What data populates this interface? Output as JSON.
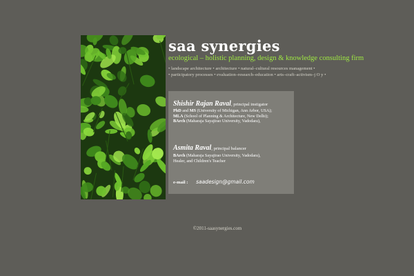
{
  "brand": {
    "title": "saa synergies",
    "tagline": "ecological – holistic planning, design & knowledge consulting firm"
  },
  "services": {
    "line1": "• landscape architecture • architecture • natural–cultural resources management •",
    "line2": "• participatory processes • evaluation–research–education • arts–craft–activism–j O y •"
  },
  "photo": {
    "subject": "green leaves"
  },
  "people": [
    {
      "name": "Shishir Rajan Raval",
      "role": ", principal instigator",
      "credentials": [
        {
          "degree": "PhD",
          "connector": " and ",
          "degree2": "MS",
          "detail": " (University of Michigan, Ann Arbor, USA);"
        },
        {
          "degree": "MLA",
          "detail": " (School of Planning & Architecture, New Delhi);"
        },
        {
          "degree": "BArch",
          "detail": " (Maharaja Sayajirao University, Vadodara),"
        }
      ]
    },
    {
      "name": "Asmita Raval",
      "role": ", principal balancer",
      "credentials": [
        {
          "degree": "BArch",
          "detail": " (Maharaja Sayajirao University, Vadodara),"
        },
        {
          "degree": "",
          "detail": "Healer, and Children's Teacher"
        }
      ]
    }
  ],
  "contact": {
    "email_label": "e-mail :",
    "email": "saadesign@gmail.com"
  },
  "footer": {
    "copyright": "©2011-saasynergies.com"
  },
  "colors": {
    "background": "#5e5d58",
    "card": "#7f7e78",
    "tagline": "#9ee842"
  }
}
